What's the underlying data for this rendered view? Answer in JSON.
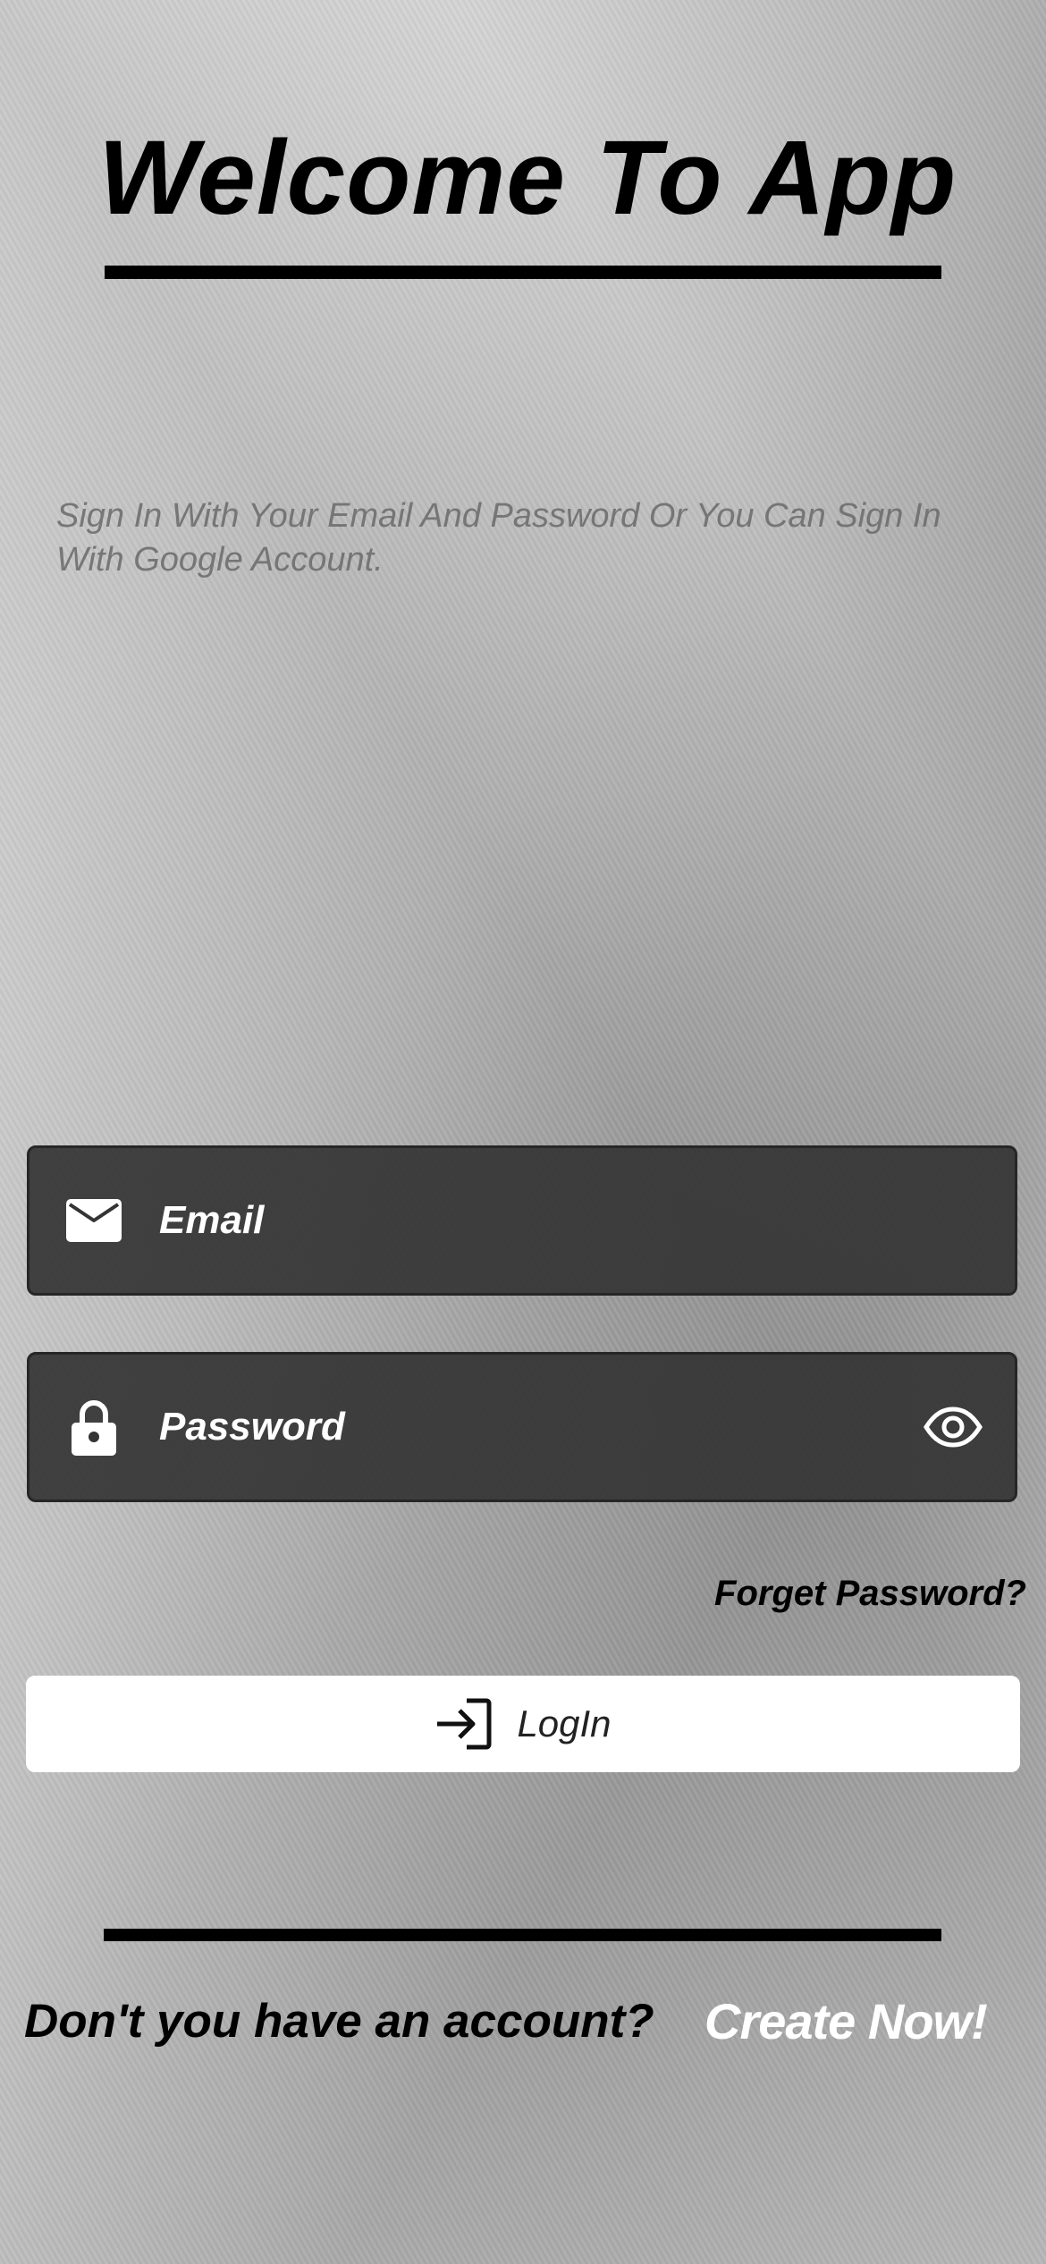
{
  "header": {
    "title": "Welcome To App",
    "subtitle": "Sign In With Your Email And Password Or You Can Sign In With Google Account."
  },
  "form": {
    "email_placeholder": "Email",
    "password_placeholder": "Password",
    "forgot_label": "Forget Password?",
    "login_label": "LogIn"
  },
  "footer": {
    "question": "Don't you have an account?",
    "create_label": "Create Now!"
  },
  "icons": {
    "email": "mail-icon",
    "password": "lock-icon",
    "visibility": "eye-icon",
    "login": "login-icon"
  },
  "colors": {
    "field_bg": "#343434",
    "button_bg": "#ffffff",
    "text_dark": "#000000",
    "text_light": "#ffffff"
  }
}
